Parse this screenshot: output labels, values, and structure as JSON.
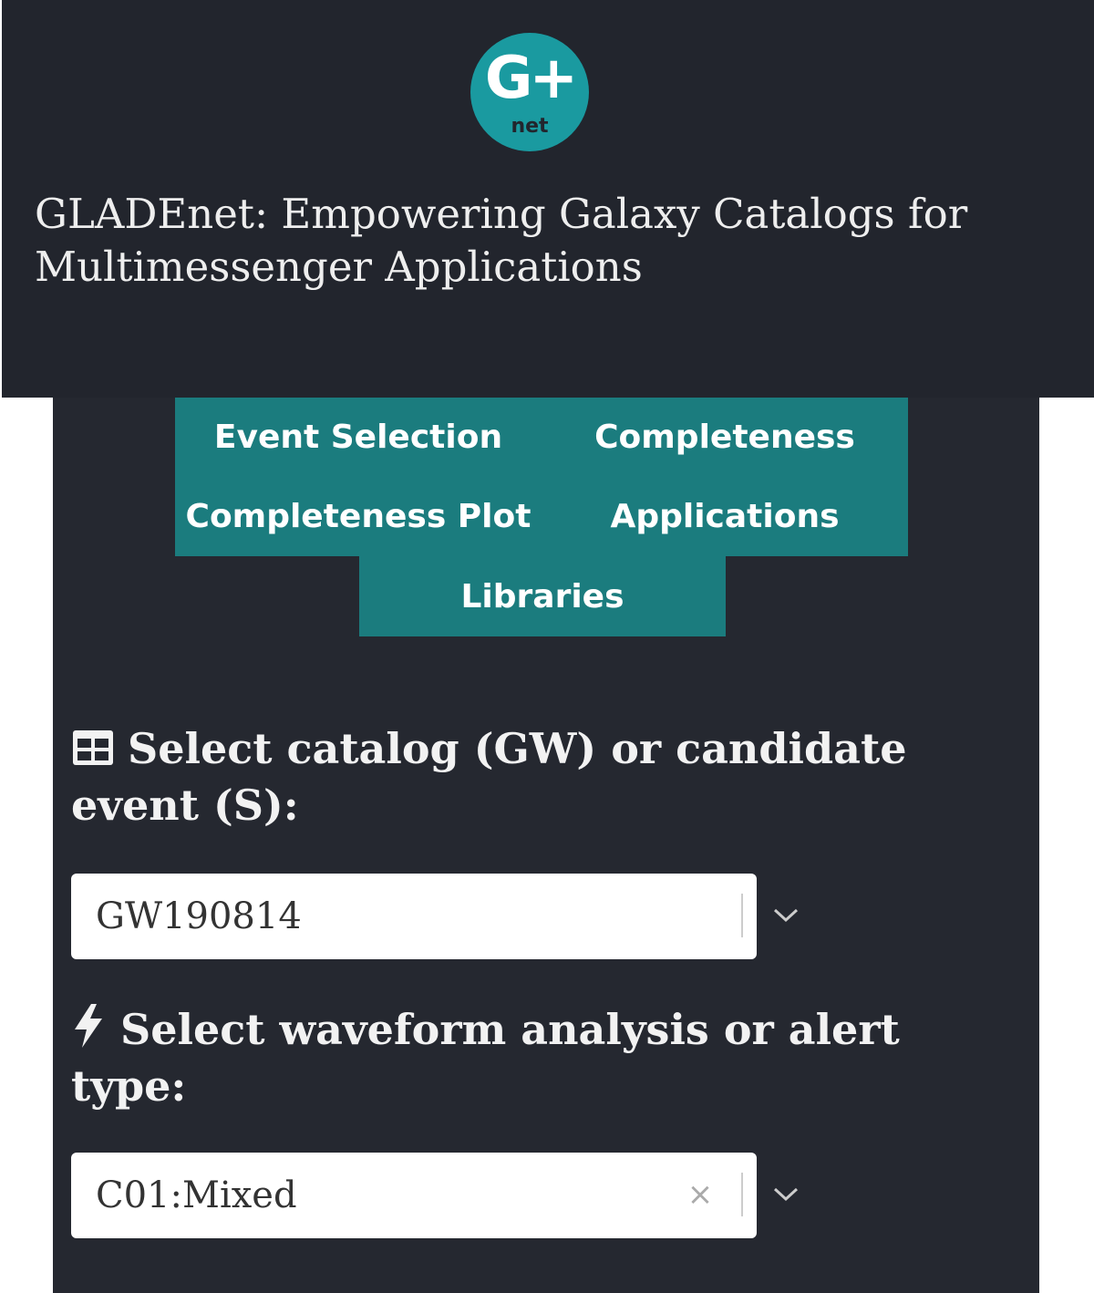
{
  "header": {
    "logo": {
      "main": "G+",
      "sub": "net"
    },
    "title": "GLADEnet: Empowering Galaxy Catalogs for Multimessenger Applications"
  },
  "tabs": [
    {
      "label": "Event Selection"
    },
    {
      "label": "Completeness"
    },
    {
      "label": "Completeness Plot"
    },
    {
      "label": "Applications"
    },
    {
      "label": "Libraries"
    }
  ],
  "catalog": {
    "icon": "table-icon",
    "label": "Select catalog (GW) or candidate event (S):",
    "value": "GW190814"
  },
  "waveform": {
    "icon": "lightning-bolt-icon",
    "label": "Select waveform analysis or alert type:",
    "value": "C01:Mixed",
    "clear": "×"
  },
  "colors": {
    "header_bg": "#22252d",
    "panel_bg": "#252830",
    "tab_bg": "#1b7c7e",
    "logo_bg": "#1a9aa0"
  }
}
